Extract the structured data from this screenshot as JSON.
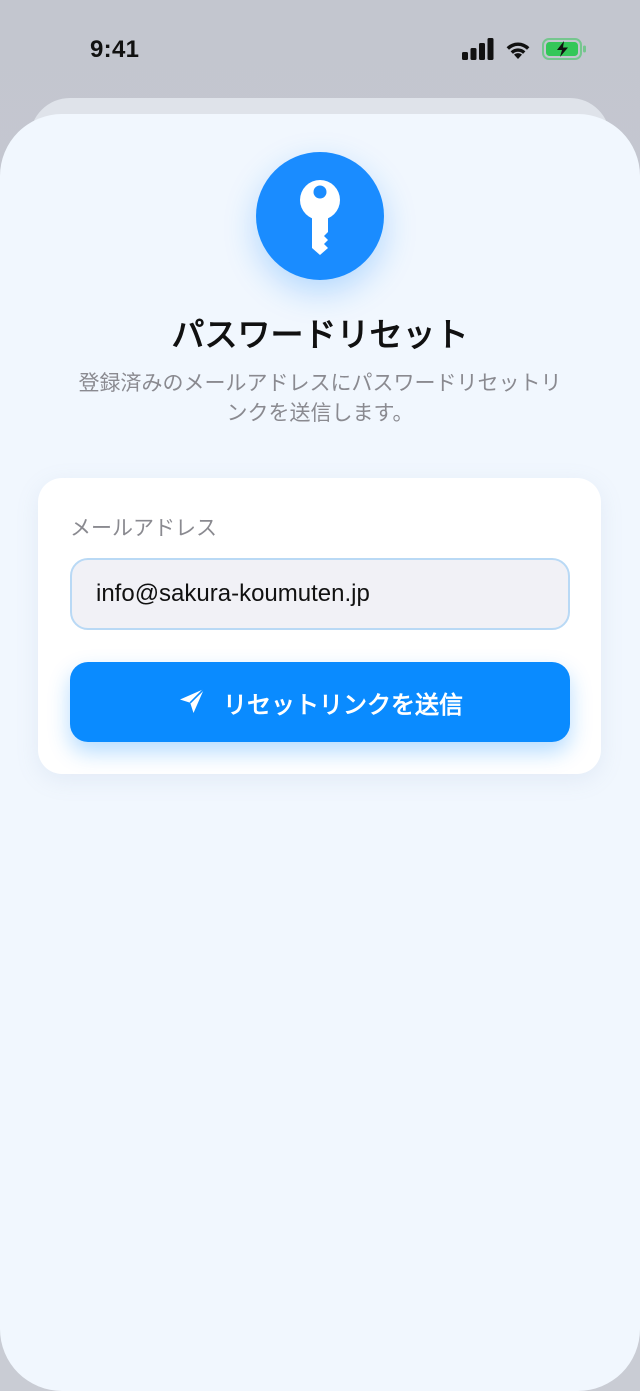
{
  "status_bar": {
    "time": "9:41",
    "signal_icon": "cellular-signal-icon",
    "wifi_icon": "wifi-icon",
    "battery_icon": "battery-charging-icon",
    "battery_color": "#34c759"
  },
  "header": {
    "icon": "key-icon",
    "icon_bg_color": "#1a8cff",
    "title": "パスワードリセット",
    "subtitle": "登録済みのメールアドレスにパスワードリセットリンクを送信します。"
  },
  "form": {
    "email_label": "メールアドレス",
    "email_value": "info@sakura-koumuten.jp",
    "submit_icon": "paper-plane-icon",
    "submit_label": "リセットリンクを送信",
    "accent_color": "#0a8bff"
  }
}
